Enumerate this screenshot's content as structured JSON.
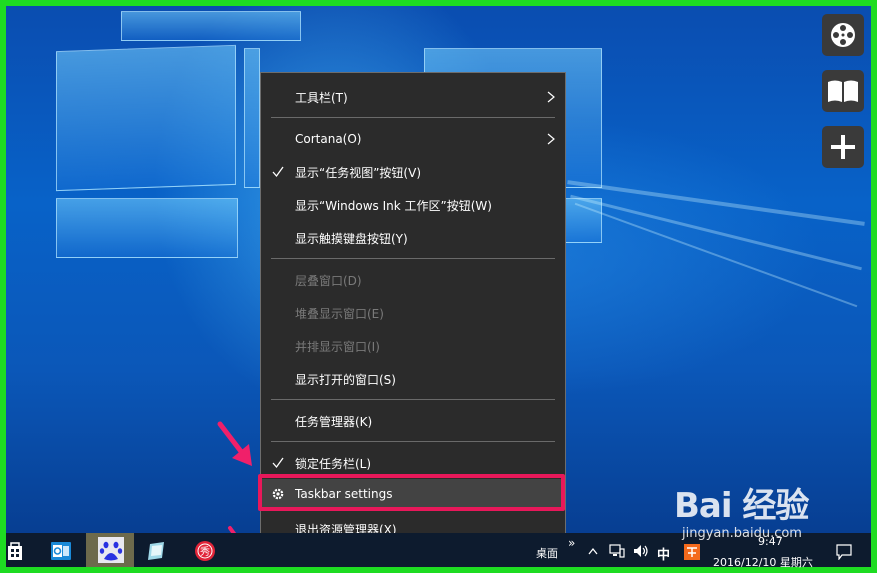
{
  "menu": {
    "items": [
      {
        "label": "工具栏(T)",
        "checked": false,
        "disabled": false,
        "submenu": true
      },
      {
        "label": "Cortana(O)",
        "checked": false,
        "disabled": false,
        "submenu": true
      },
      {
        "label": "显示“任务视图”按钮(V)",
        "checked": true,
        "disabled": false,
        "submenu": false
      },
      {
        "label": "显示“Windows Ink 工作区”按钮(W)",
        "checked": false,
        "disabled": false,
        "submenu": false
      },
      {
        "label": "显示触摸键盘按钮(Y)",
        "checked": false,
        "disabled": false,
        "submenu": false
      },
      {
        "label": "层叠窗口(D)",
        "checked": false,
        "disabled": true,
        "submenu": false
      },
      {
        "label": "堆叠显示窗口(E)",
        "checked": false,
        "disabled": true,
        "submenu": false
      },
      {
        "label": "并排显示窗口(I)",
        "checked": false,
        "disabled": true,
        "submenu": false
      },
      {
        "label": "显示打开的窗口(S)",
        "checked": false,
        "disabled": false,
        "submenu": false
      },
      {
        "label": "任务管理器(K)",
        "checked": false,
        "disabled": false,
        "submenu": false
      },
      {
        "label": "锁定任务栏(L)",
        "checked": true,
        "disabled": false,
        "submenu": false
      },
      {
        "label": "Taskbar settings",
        "checked": false,
        "disabled": false,
        "submenu": false
      },
      {
        "label": "退出资源管理器(X)",
        "checked": false,
        "disabled": false,
        "submenu": false
      }
    ],
    "highlight_color": "#e8185a"
  },
  "taskbar": {
    "desktop_label": "桌面",
    "overflow": "»",
    "ime": "中",
    "time": "9:47",
    "date": "2016/12/10 星期六"
  },
  "watermark": {
    "brand": "Bai 经验",
    "url": "jingyan.baidu.com"
  }
}
